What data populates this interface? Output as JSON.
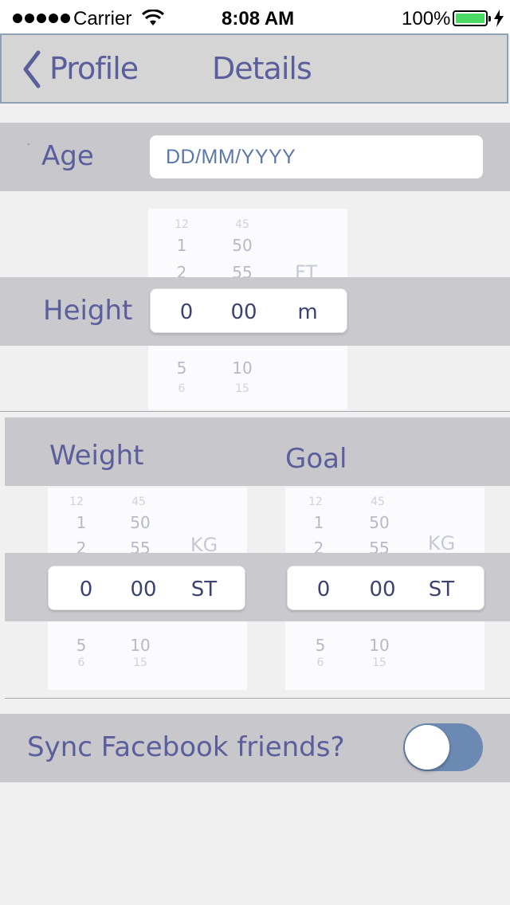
{
  "status_bar": {
    "carrier": "Carrier",
    "time": "8:08 AM",
    "battery": "100%"
  },
  "nav": {
    "back_label": "Profile",
    "title": "Details"
  },
  "age": {
    "label": "Age",
    "placeholder": "DD/MM/YYYY"
  },
  "height": {
    "label": "Height",
    "selected": [
      "0",
      "00",
      "m"
    ],
    "col1_above": [
      "12",
      "1",
      "2"
    ],
    "col1_below": [
      "5",
      "6"
    ],
    "col2_above": [
      "45",
      "50",
      "55"
    ],
    "col2_below": [
      "10",
      "15"
    ],
    "unit_above": "FT"
  },
  "weight": {
    "label": "Weight",
    "selected": [
      "0",
      "00",
      "ST"
    ],
    "col1_above": [
      "12",
      "1",
      "2"
    ],
    "col1_below": [
      "5",
      "6"
    ],
    "col2_above": [
      "45",
      "50",
      "55"
    ],
    "col2_below": [
      "10",
      "15"
    ],
    "unit_above": "KG"
  },
  "goal": {
    "label": "Goal",
    "selected": [
      "0",
      "00",
      "ST"
    ],
    "col1_above": [
      "12",
      "1",
      "2"
    ],
    "col1_below": [
      "5",
      "6"
    ],
    "col2_above": [
      "45",
      "50",
      "55"
    ],
    "col2_below": [
      "10",
      "15"
    ],
    "unit_above": "KG"
  },
  "sync": {
    "label": "Sync Facebook friends?",
    "enabled": false
  },
  "colors": {
    "accent": "#5a5f9c",
    "band": "#c7c7cc",
    "toggle": "#6b89b2"
  }
}
